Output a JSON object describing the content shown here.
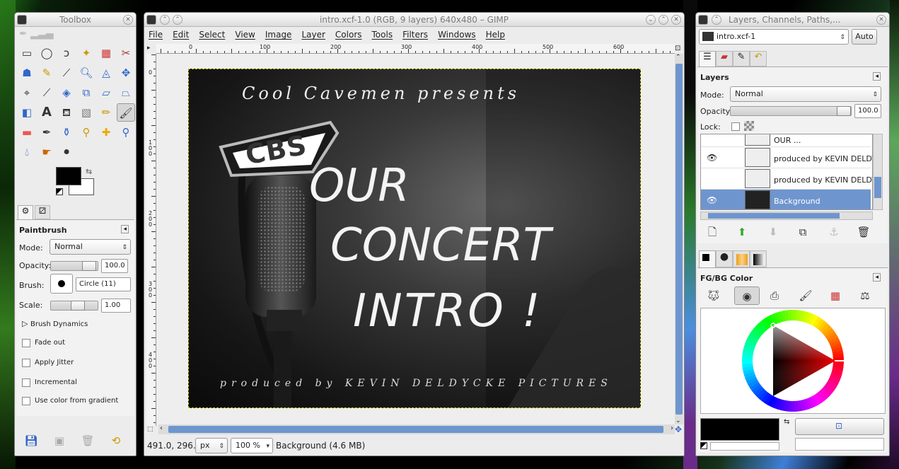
{
  "toolbox": {
    "title": "Toolbox",
    "options_title": "Paintbrush",
    "mode_label": "Mode:",
    "mode_value": "Normal",
    "opacity_label": "Opacity:",
    "opacity_value": "100.0",
    "brush_label": "Brush:",
    "brush_value": "Circle (11)",
    "scale_label": "Scale:",
    "scale_value": "1.00",
    "dynamics_label": "Brush Dynamics",
    "opts": [
      "Fade out",
      "Apply Jitter",
      "Incremental",
      "Use color from gradient"
    ]
  },
  "image": {
    "title": "intro.xcf-1.0 (RGB, 9 layers) 640x480 – GIMP",
    "menu": [
      "File",
      "Edit",
      "Select",
      "View",
      "Image",
      "Layer",
      "Colors",
      "Tools",
      "Filters",
      "Windows",
      "Help"
    ],
    "ruler_h": [
      "0",
      "100",
      "200",
      "300",
      "400",
      "500",
      "600"
    ],
    "ruler_v": [
      "0",
      "1\n0\n0",
      "2\n0\n0",
      "3\n0\n0",
      "4\n0\n0"
    ],
    "canvas": {
      "line1": "Cool Cavemen presents",
      "badge": "CBS",
      "line2": "OUR",
      "line3": "CONCERT",
      "line4": "INTRO !",
      "line5": "produced by KEVIN DELDYCKE PICTURES"
    },
    "status": {
      "coords": "491.0, 296.0",
      "unit": "px",
      "zoom": "100 %",
      "info": "Background (4.6 MB)"
    }
  },
  "dock": {
    "title": "Layers, Channels, Paths,...",
    "image_select": "intro.xcf-1",
    "auto": "Auto",
    "layers_title": "Layers",
    "mode_label": "Mode:",
    "mode_value": "Normal",
    "opacity_label": "Opacity:",
    "opacity_value": "100.0",
    "lock_label": "Lock:",
    "layers": [
      {
        "name": "OUR ...",
        "visible": false
      },
      {
        "name": "produced by KEVIN DELDYCKE",
        "visible": true
      },
      {
        "name": "produced by KEVIN DELDYCKE",
        "visible": false
      },
      {
        "name": "Background",
        "visible": true,
        "selected": true
      }
    ],
    "fgbg_title": "FG/BG Color"
  },
  "colors": {
    "fg": "#000000",
    "bg": "#ffffff",
    "accent": "#6f95cf"
  }
}
